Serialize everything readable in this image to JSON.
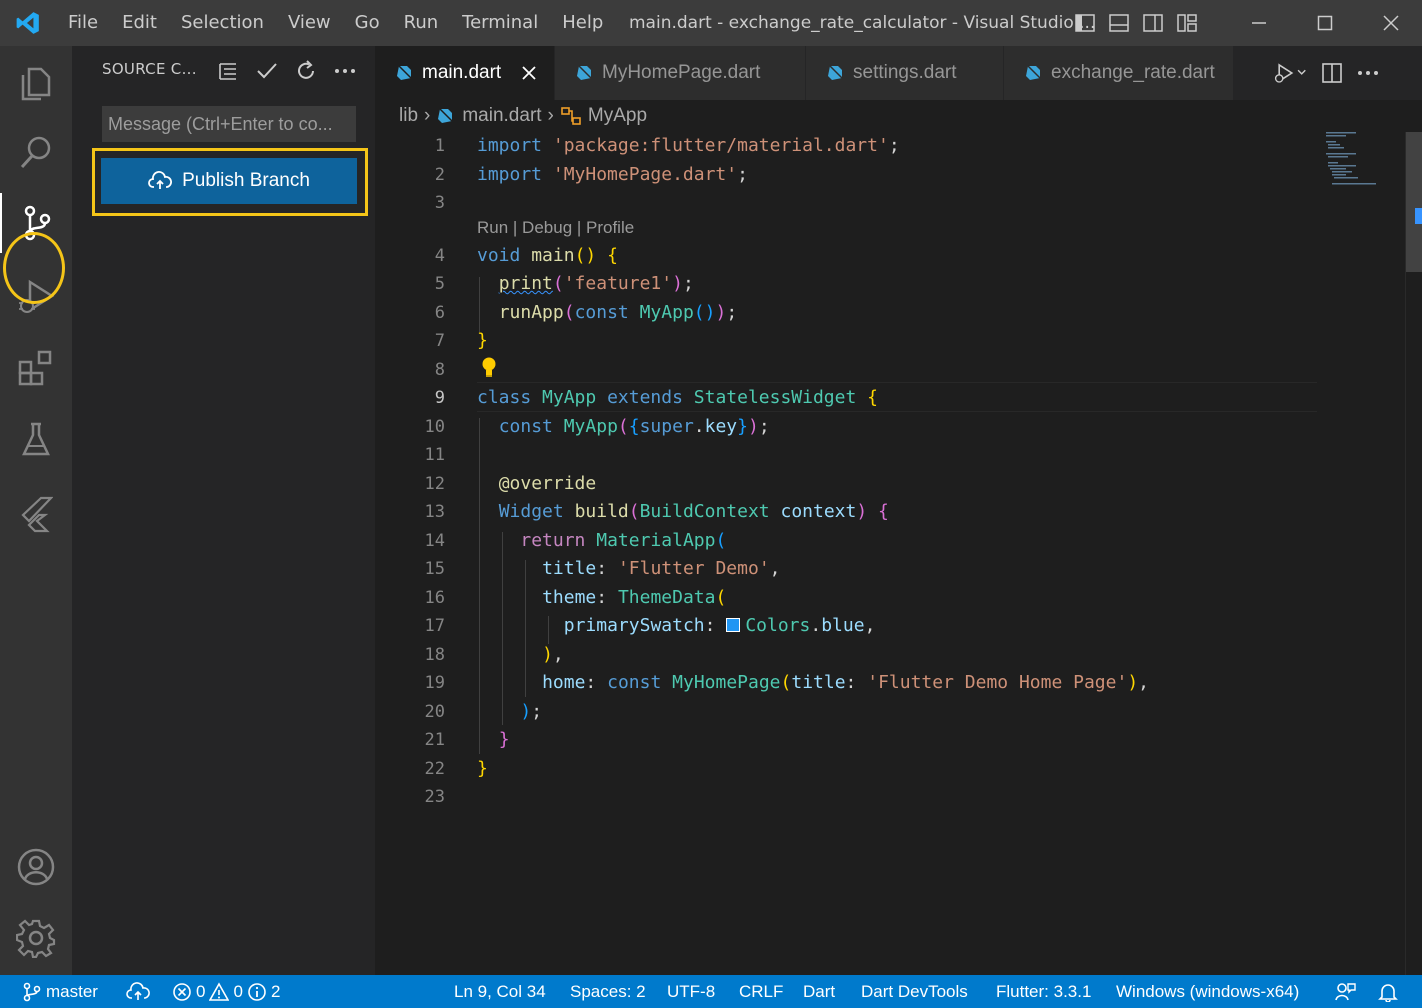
{
  "titlebar": {
    "menu": [
      "File",
      "Edit",
      "Selection",
      "View",
      "Go",
      "Run",
      "Terminal",
      "Help"
    ],
    "window_title": "main.dart - exchange_rate_calculator - Visual Studio ..."
  },
  "activity": {
    "items": [
      "explorer-icon",
      "search-icon",
      "source-control-icon",
      "run-debug-icon",
      "extensions-icon",
      "testing-icon",
      "flutter-icon",
      "accounts-icon",
      "settings-gear-icon"
    ],
    "highlight_color": "#f5c518"
  },
  "sidebar": {
    "title": "SOURCE C...",
    "message_placeholder": "Message (Ctrl+Enter to co...",
    "publish_label": "Publish Branch"
  },
  "tabs": [
    {
      "label": "main.dart",
      "active": true
    },
    {
      "label": "MyHomePage.dart",
      "active": false
    },
    {
      "label": "settings.dart",
      "active": false
    },
    {
      "label": "exchange_rate.dart",
      "active": false
    }
  ],
  "breadcrumb": {
    "folder": "lib",
    "file": "main.dart",
    "symbol": "MyApp"
  },
  "codelens": "Run | Debug | Profile",
  "editor": {
    "line_numbers": [
      "1",
      "2",
      "3",
      "4",
      "5",
      "6",
      "7",
      "8",
      "9",
      "10",
      "11",
      "12",
      "13",
      "14",
      "15",
      "16",
      "17",
      "18",
      "19",
      "20",
      "21",
      "22",
      "23"
    ],
    "current_line": "9",
    "code": [
      "import 'package:flutter/material.dart';",
      "import 'MyHomePage.dart';",
      "",
      "void main() {",
      "  print('feature1');",
      "  runApp(const MyApp());",
      "}",
      "",
      "class MyApp extends StatelessWidget {",
      "  const MyApp({super.key});",
      "",
      "  @override",
      "  Widget build(BuildContext context) {",
      "    return MaterialApp(",
      "      title: 'Flutter Demo',",
      "      theme: ThemeData(",
      "        primarySwatch: Colors.blue,",
      "      ),",
      "      home: const MyHomePage(title: 'Flutter Demo Home Page'),",
      "    );",
      "  }",
      "}",
      ""
    ]
  },
  "statusbar": {
    "branch": "master",
    "errors": "0",
    "warnings": "0",
    "infos": "2",
    "position": "Ln 9, Col 34",
    "spaces": "Spaces: 2",
    "encoding": "UTF-8",
    "eol": "CRLF",
    "language": "Dart",
    "devtools": "Dart DevTools",
    "flutter": "Flutter: 3.3.1",
    "device": "Windows (windows-x64)"
  },
  "colors": {
    "accent": "#007acc",
    "button": "#0e639c",
    "highlight": "#f5c518"
  }
}
